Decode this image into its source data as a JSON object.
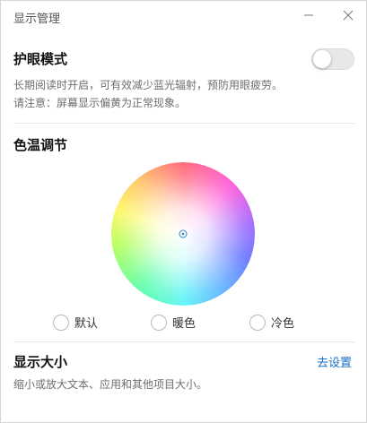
{
  "window": {
    "title": "显示管理"
  },
  "eye_care": {
    "title": "护眼模式",
    "toggle_on": false,
    "desc_line1": "长期阅读时开启，可有效减少蓝光辐射，预防用眼疲劳。",
    "desc_line2": "请注意：屏幕显示偏黄为正常现象。"
  },
  "color_temp": {
    "title": "色温调节",
    "options": [
      {
        "label": "默认",
        "selected": false
      },
      {
        "label": "暖色",
        "selected": false
      },
      {
        "label": "冷色",
        "selected": false
      }
    ]
  },
  "display_size": {
    "title": "显示大小",
    "link": "去设置",
    "desc": "缩小或放大文本、应用和其他项目大小。"
  },
  "icons": {
    "minimize": "minimize-icon",
    "close": "close-icon",
    "wheel_center": "crosshair-icon"
  }
}
